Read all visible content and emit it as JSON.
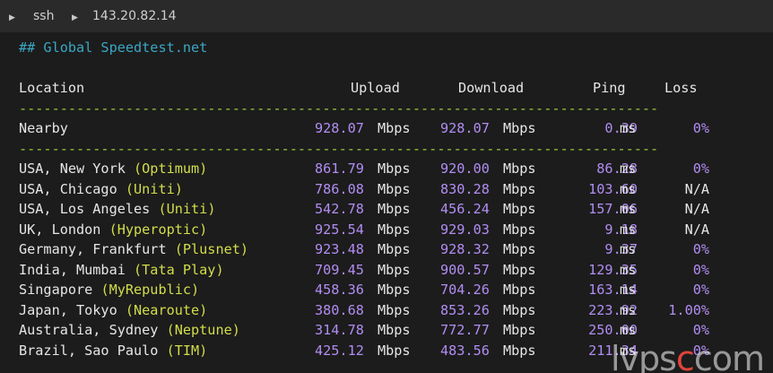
{
  "titlebar": {
    "app": "ssh",
    "host": "143.20.82.14"
  },
  "section_title": "## Global Speedtest.net",
  "columns": {
    "location": "Location",
    "upload": "Upload",
    "download": "Download",
    "ping": "Ping",
    "loss": "Loss"
  },
  "separator": "------------------------------------------------------------------------------",
  "units": {
    "speed": "Mbps",
    "ping": "ms"
  },
  "nearby": {
    "location": "Nearby",
    "upload": "928.07",
    "download": "928.07",
    "ping": "0.39",
    "loss": "0%"
  },
  "rows": [
    {
      "loc": "USA, New York ",
      "isp": "(Optimum)",
      "upload": "861.79",
      "download": "920.00",
      "ping": "86.28",
      "loss": "0%"
    },
    {
      "loc": "USA, Chicago ",
      "isp": "(Uniti)",
      "upload": "786.08",
      "download": "830.28",
      "ping": "103.60",
      "loss": "N/A"
    },
    {
      "loc": "USA, Los Angeles ",
      "isp": "(Uniti)",
      "upload": "542.78",
      "download": "456.24",
      "ping": "157.06",
      "loss": "N/A"
    },
    {
      "loc": "UK, London ",
      "isp": "(Hyperoptic)",
      "upload": "925.54",
      "download": "929.03",
      "ping": "9.18",
      "loss": "N/A"
    },
    {
      "loc": "Germany, Frankfurt ",
      "isp": "(Plusnet)",
      "upload": "923.48",
      "download": "928.32",
      "ping": "9.37",
      "loss": "0%"
    },
    {
      "loc": "India, Mumbai ",
      "isp": "(Tata Play)",
      "upload": "709.45",
      "download": "900.57",
      "ping": "129.35",
      "loss": "0%"
    },
    {
      "loc": "Singapore ",
      "isp": "(MyRepublic)",
      "upload": "458.36",
      "download": "704.26",
      "ping": "163.14",
      "loss": "0%"
    },
    {
      "loc": "Japan, Tokyo ",
      "isp": "(Nearoute)",
      "upload": "380.68",
      "download": "853.26",
      "ping": "223.92",
      "loss": "1.00%"
    },
    {
      "loc": "Australia, Sydney ",
      "isp": "(Neptune)",
      "upload": "314.78",
      "download": "772.77",
      "ping": "250.00",
      "loss": "0%"
    },
    {
      "loc": "Brazil, Sao Paulo ",
      "isp": "(TIM)",
      "upload": "425.12",
      "download": "483.56",
      "ping": "211.34",
      "loss": "0%"
    }
  ],
  "watermark": {
    "pre": "lvps",
    "dot": "c",
    "post": "com"
  },
  "colors": {
    "background": "#1c1c1c",
    "titlebar": "#2a2a2a",
    "heading": "#3ba7c4",
    "separator": "#9ccc3b",
    "number": "#b18df2",
    "isp": "#d2dd4a"
  }
}
